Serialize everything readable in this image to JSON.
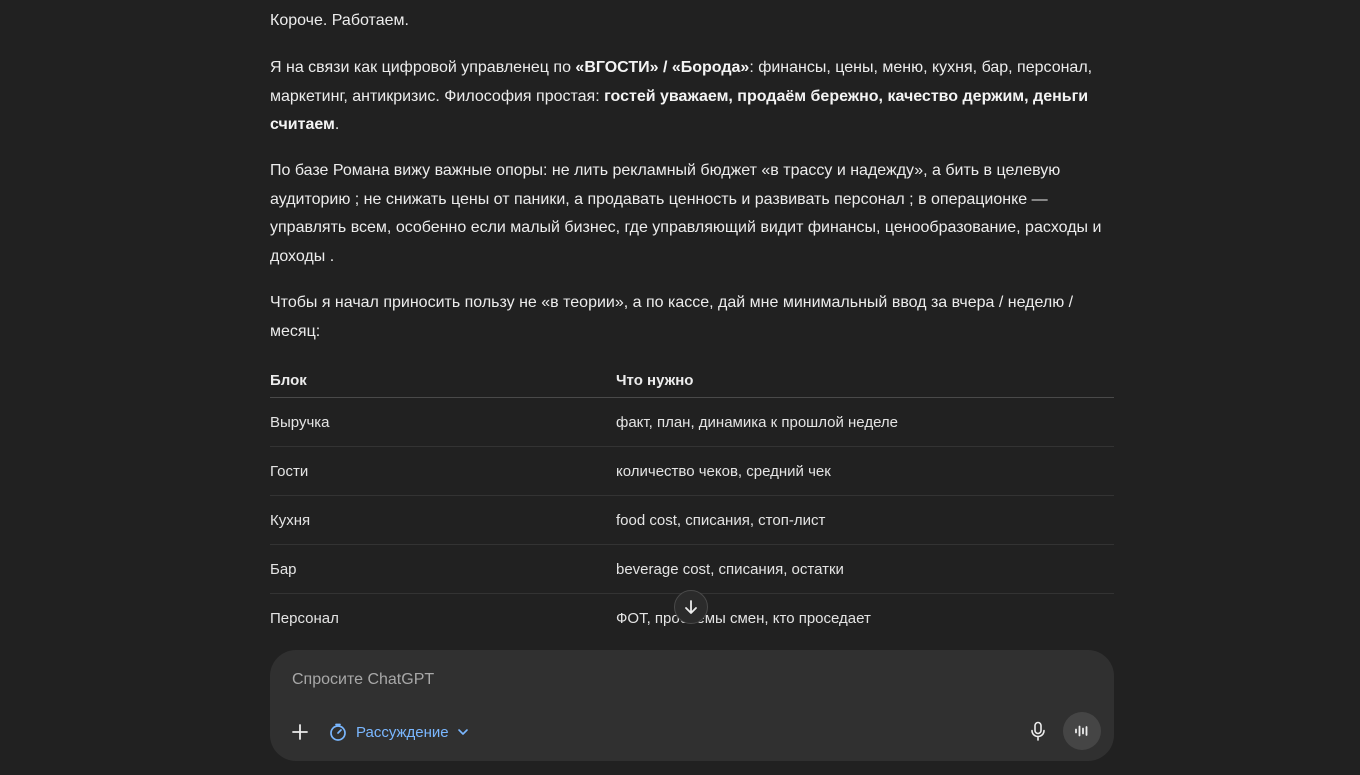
{
  "message": {
    "p0": "Короче. Работаем.",
    "p1_a": "Я на связи как цифровой управленец по ",
    "p1_b": "«ВГОСТИ» / «Борода»",
    "p1_c": ": финансы, цены, меню, кухня, бар, персонал, маркетинг, антикризис. Философия простая: ",
    "p1_d": "гостей уважаем, продаём бережно, качество держим, деньги считаем",
    "p1_e": ".",
    "p2": "По базе Романа вижу важные опоры: не лить рекламный бюджет «в трассу и надежду», а бить в целевую аудиторию ; не снижать цены от паники, а продавать ценность и развивать персонал ; в операционке — управлять всем, особенно если малый бизнес, где управляющий видит финансы, ценообразование, расходы и доходы .",
    "p3": "Чтобы я начал приносить пользу не «в теории», а по кассе, дай мне минимальный ввод за вчера / неделю / месяц:"
  },
  "table": {
    "headers": [
      "Блок",
      "Что нужно"
    ],
    "rows": [
      [
        "Выручка",
        "факт, план, динамика к прошлой неделе"
      ],
      [
        "Гости",
        "количество чеков, средний чек"
      ],
      [
        "Кухня",
        "food cost, списания, стоп-лист"
      ],
      [
        "Бар",
        "beverage cost, списания, остатки"
      ],
      [
        "Персонал",
        "ФОТ, проблемы смен, кто проседает"
      ]
    ]
  },
  "composer": {
    "placeholder": "Спросите ChatGPT",
    "reasoning_label": "Рассуждение"
  },
  "icons": {
    "scroll": "arrow-down-icon",
    "add": "plus-icon",
    "reasoning": "timer-icon",
    "dropdown": "chevron-down-icon",
    "mic": "microphone-icon",
    "voice": "voice-waveform-icon"
  },
  "colors": {
    "background": "#212121",
    "composer": "#303030",
    "accent": "#7ab7ff"
  }
}
